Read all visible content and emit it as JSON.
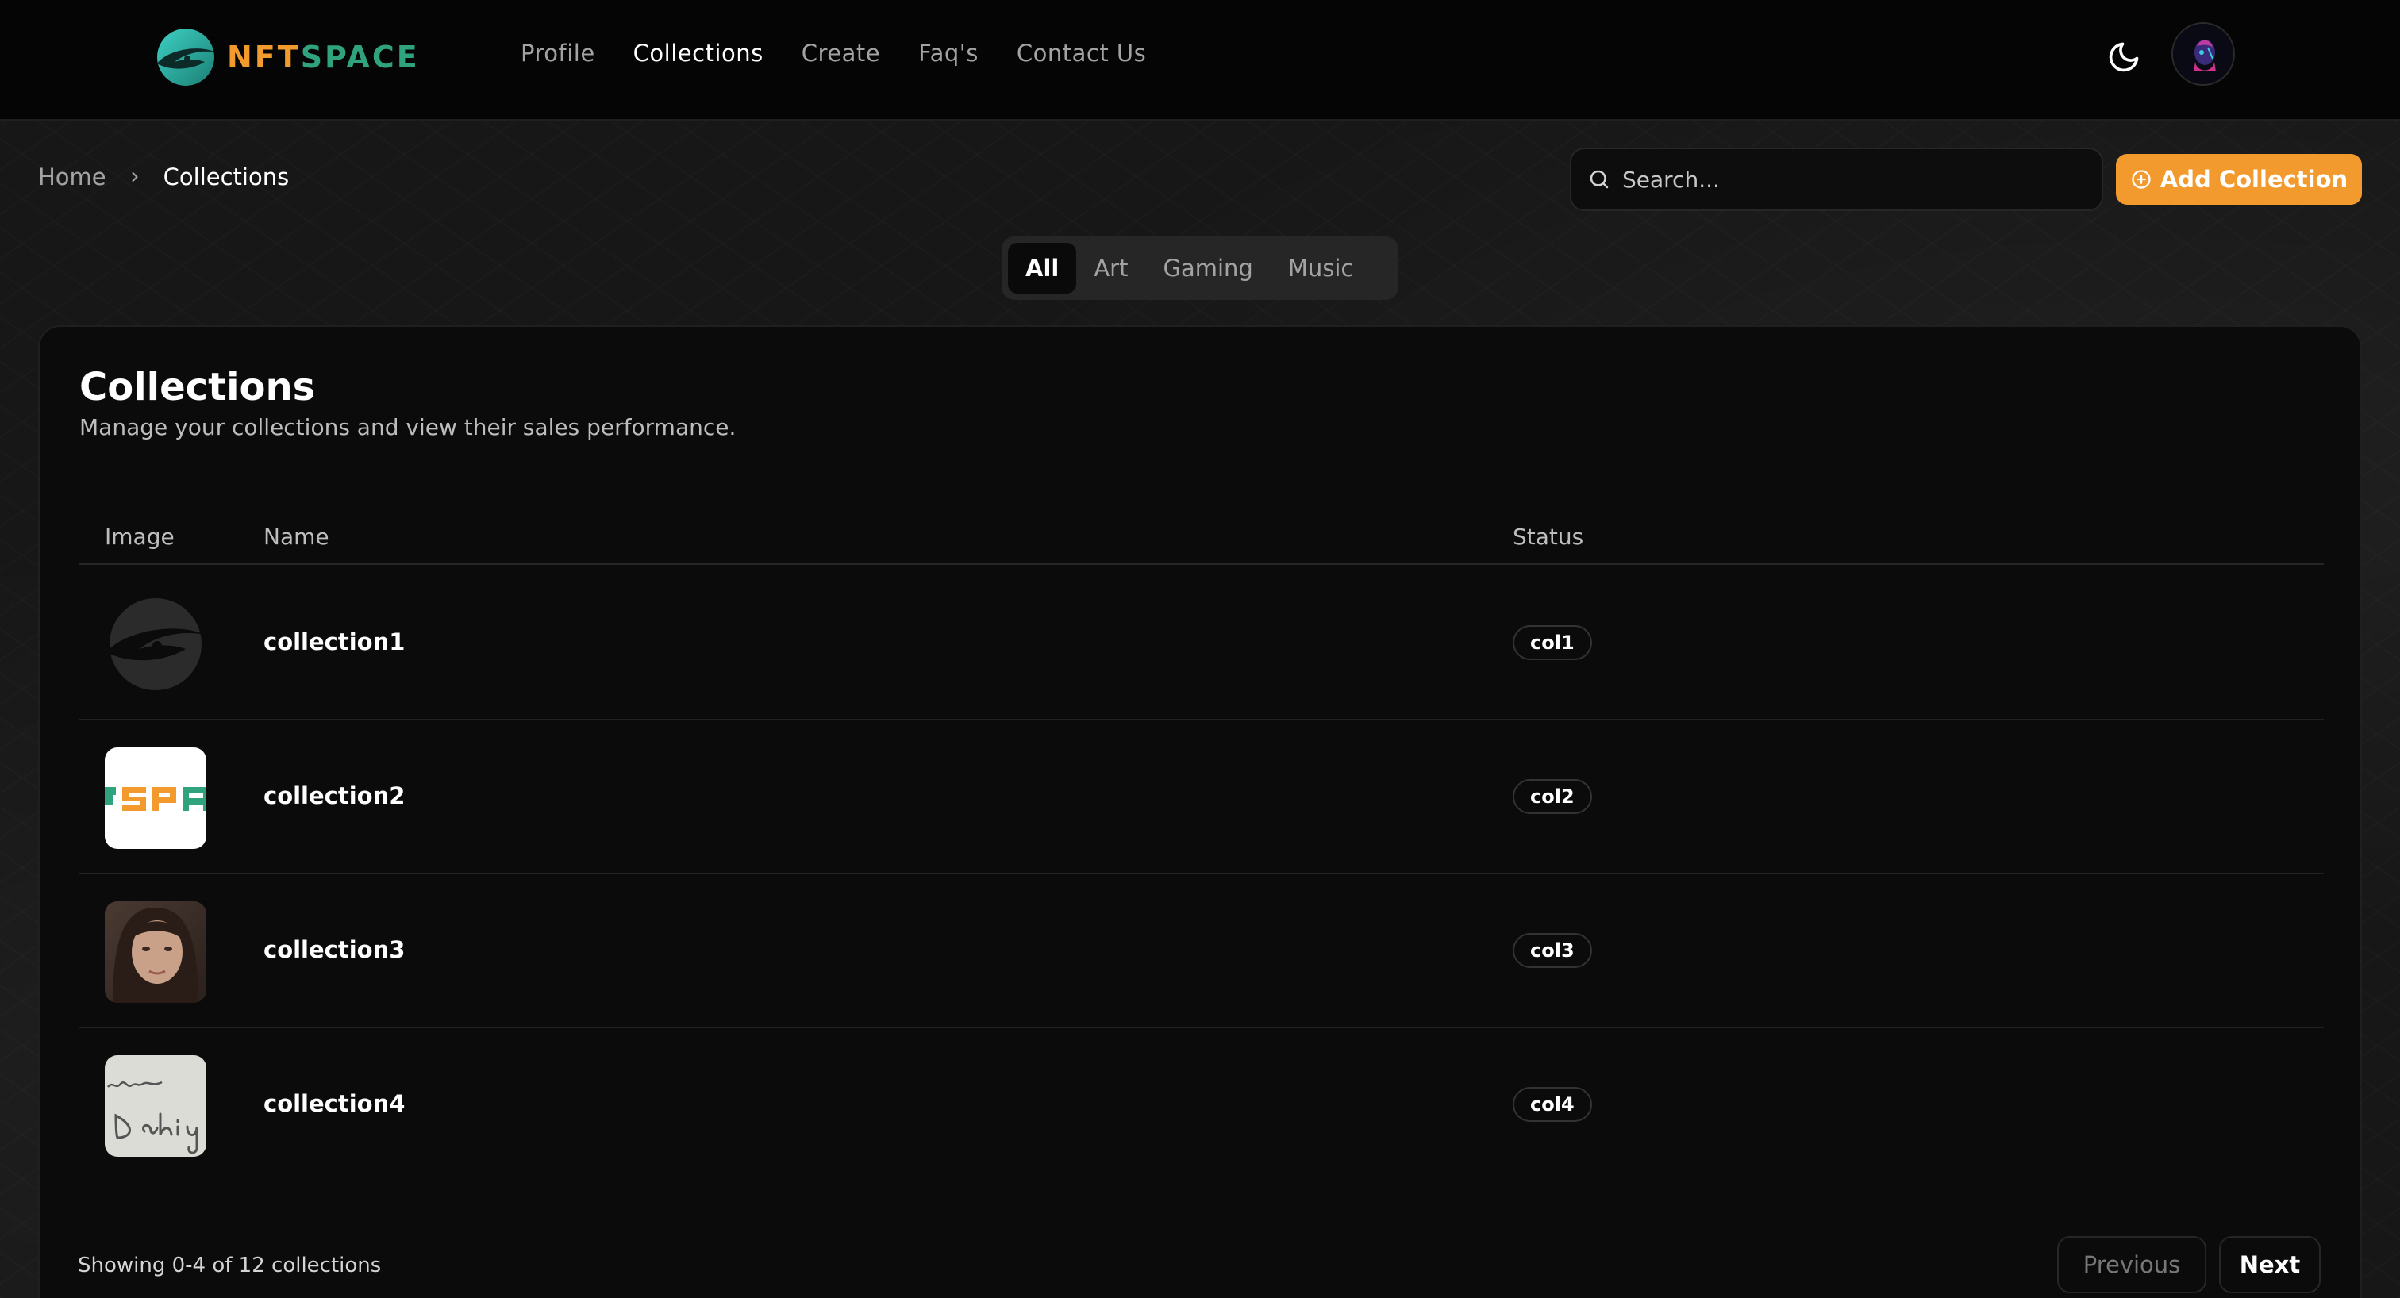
{
  "header": {
    "logo_text_part1": "NFT",
    "logo_text_part2": "SPACE",
    "nav": [
      {
        "label": "Profile",
        "active": false
      },
      {
        "label": "Collections",
        "active": true
      },
      {
        "label": "Create",
        "active": false
      },
      {
        "label": "Faq's",
        "active": false
      },
      {
        "label": "Contact Us",
        "active": false
      }
    ],
    "theme_icon": "moon-icon"
  },
  "breadcrumb": {
    "home": "Home",
    "separator_icon": "chevron-right-icon",
    "current": "Collections"
  },
  "search": {
    "placeholder": "Search...",
    "value": ""
  },
  "add_button": {
    "label": "Add Collection",
    "icon": "plus-circle-icon"
  },
  "tabs": [
    {
      "label": "All",
      "active": true
    },
    {
      "label": "Art",
      "active": false
    },
    {
      "label": "Gaming",
      "active": false
    },
    {
      "label": "Music",
      "active": false
    }
  ],
  "card": {
    "title": "Collections",
    "description": "Manage your collections and view their sales performance."
  },
  "table": {
    "columns": [
      "Image",
      "Name",
      "Status"
    ],
    "rows": [
      {
        "name": "collection1",
        "status": "col1",
        "image": "logo-mark"
      },
      {
        "name": "collection2",
        "status": "col2",
        "image": "text-logo-crop"
      },
      {
        "name": "collection3",
        "status": "col3",
        "image": "portrait-photo"
      },
      {
        "name": "collection4",
        "status": "col4",
        "image": "handwriting"
      }
    ]
  },
  "pagination": {
    "summary": "Showing 0-4 of 12 collections",
    "previous": "Previous",
    "next": "Next"
  },
  "colors": {
    "accent": "#f29a2e",
    "brand_green": "#2fa37e",
    "background": "#171717",
    "card": "#0b0b0b"
  }
}
